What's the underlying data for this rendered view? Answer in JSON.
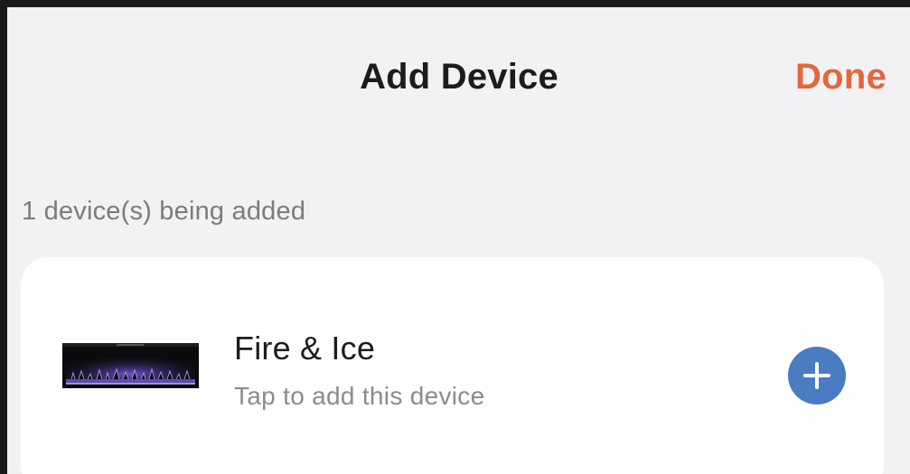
{
  "header": {
    "title": "Add Device",
    "done_label": "Done"
  },
  "section": {
    "caption": "1 device(s) being added"
  },
  "device": {
    "name": "Fire & Ice",
    "hint": "Tap to add this device",
    "image": "electric-fireplace-thumbnail",
    "action_icon": "plus-circle-icon"
  },
  "colors": {
    "accent": "#e2673f",
    "add_button": "#4a7cc1",
    "background": "#f2f2f4",
    "card": "#ffffff",
    "secondary_text": "#7b7b80"
  }
}
